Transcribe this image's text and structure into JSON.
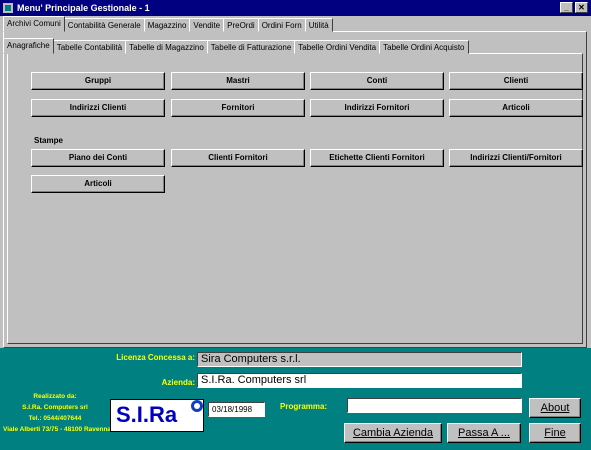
{
  "window": {
    "title": "Menu' Principale Gestionale - 1",
    "sys_buttons": [
      "_",
      "✕"
    ]
  },
  "top_tabs": [
    "Archivi Comuni",
    "Contabilità Generale",
    "Magazzino",
    "Vendite",
    "PreOrdi",
    "Ordini Forn",
    "Utilità"
  ],
  "sub_tabs": [
    "Anagrafiche",
    "Tabelle Contabilità",
    "Tabelle di Magazzino",
    "Tabelle di Fatturazione",
    "Tabelle Ordini Vendita",
    "Tabelle Ordini Acquisto"
  ],
  "anagrafiche": {
    "row1": [
      "Gruppi",
      "Mastri",
      "Conti",
      "Clienti"
    ],
    "row2": [
      "Indirizzi Clienti",
      "Fornitori",
      "Indirizzi Fornitori",
      "Articoli"
    ]
  },
  "stampe": {
    "label": "Stampe",
    "row1": [
      "Piano dei Conti",
      "Clienti Fornitori",
      "Etichette Clienti Fornitori",
      "Indirizzi Clienti/Fornitori"
    ],
    "row2": [
      "Articoli"
    ]
  },
  "footer": {
    "licenza_label": "Licenza Concessa a:",
    "licenza_value": "Sira Computers s.r.l.",
    "azienda_label": "Azienda:",
    "azienda_value": "S.I.Ra. Computers srl",
    "date_value": "03/18/1998",
    "programma_label": "Programma:",
    "programma_value": "",
    "credits": [
      "Realizzato da:",
      "S.I.Ra. Computers srl",
      "Tel.: 0544/407644",
      "Viale Alberti 73/75 - 48100 Ravenna"
    ],
    "logo_text": "S.I.Ra",
    "buttons": {
      "about": "About",
      "cambia_azienda": "Cambia Azienda",
      "passa_a": "Passa A ...",
      "fine": "Fine"
    }
  }
}
